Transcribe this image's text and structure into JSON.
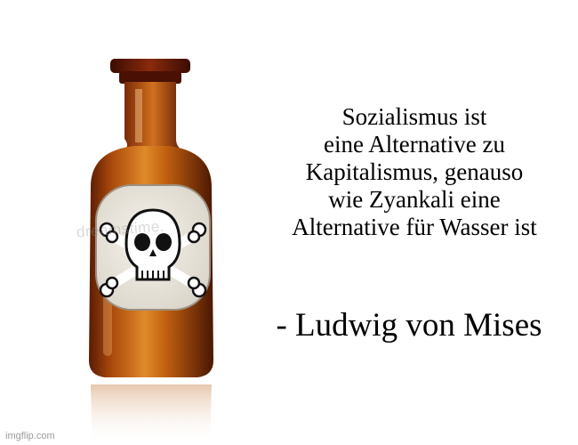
{
  "meme": {
    "quote_lines": [
      "Sozialismus ist",
      "eine Alternative zu",
      "Kapitalismus, genauso",
      "wie Zyankali eine",
      "Alternative für Wasser ist"
    ],
    "author": "- Ludwig von Mises"
  },
  "image": {
    "subject_icon": "poison-bottle-icon",
    "label_icon": "skull-crossbones-icon",
    "label_watermark": "dreamstime."
  },
  "watermark": {
    "text": "imgflip.com"
  },
  "colors": {
    "background": "#ffffff",
    "glass": "#b4500d",
    "stopper": "#5e1606",
    "label": "#ece8e0",
    "text": "#000000"
  }
}
